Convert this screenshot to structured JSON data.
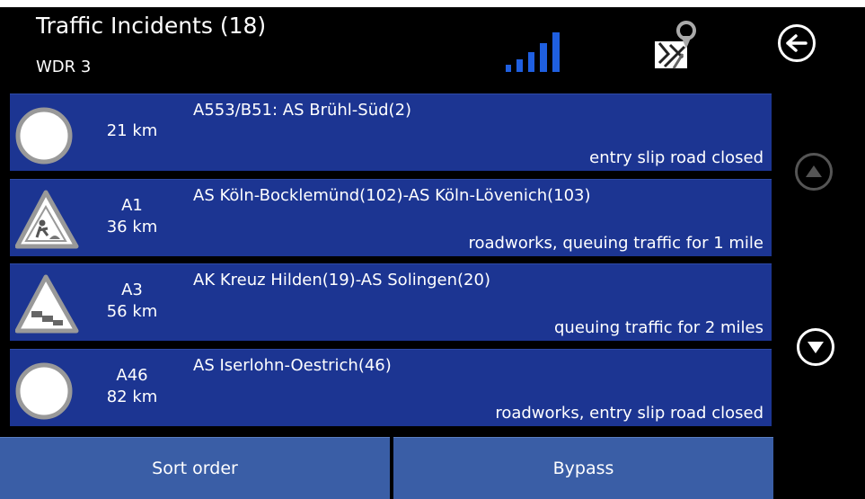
{
  "header": {
    "title": "Traffic Incidents (18)",
    "station": "WDR 3",
    "icons": [
      "signal-strength-icon",
      "map-route-icon",
      "back-arrow-icon"
    ]
  },
  "incidents": [
    {
      "road": "",
      "distance": "21 km",
      "route": "A553/B51: AS Brühl-Süd(2)",
      "description": "entry slip road closed",
      "symbol": "no-entry-circle-icon"
    },
    {
      "road": "A1",
      "distance": "36 km",
      "route": "AS Köln-Bocklemünd(102)-AS Köln-Lövenich(103)",
      "description": "roadworks, queuing traffic for 1 mile",
      "symbol": "roadworks-sign-icon"
    },
    {
      "road": "A3",
      "distance": "56 km",
      "route": "AK Kreuz Hilden(19)-AS Solingen(20)",
      "description": "queuing traffic for 2 miles",
      "symbol": "traffic-queue-sign-icon"
    },
    {
      "road": "A46",
      "distance": "82 km",
      "route": "AS Iserlohn-Oestrich(46)",
      "description": "roadworks, entry slip road closed",
      "symbol": "no-entry-circle-icon"
    }
  ],
  "buttons": {
    "sort_order": "Sort order",
    "bypass": "Bypass"
  },
  "colors": {
    "row_bg": "#1c3592",
    "button_bg": "#3a5ea6",
    "signal": "#1f5fe0"
  }
}
